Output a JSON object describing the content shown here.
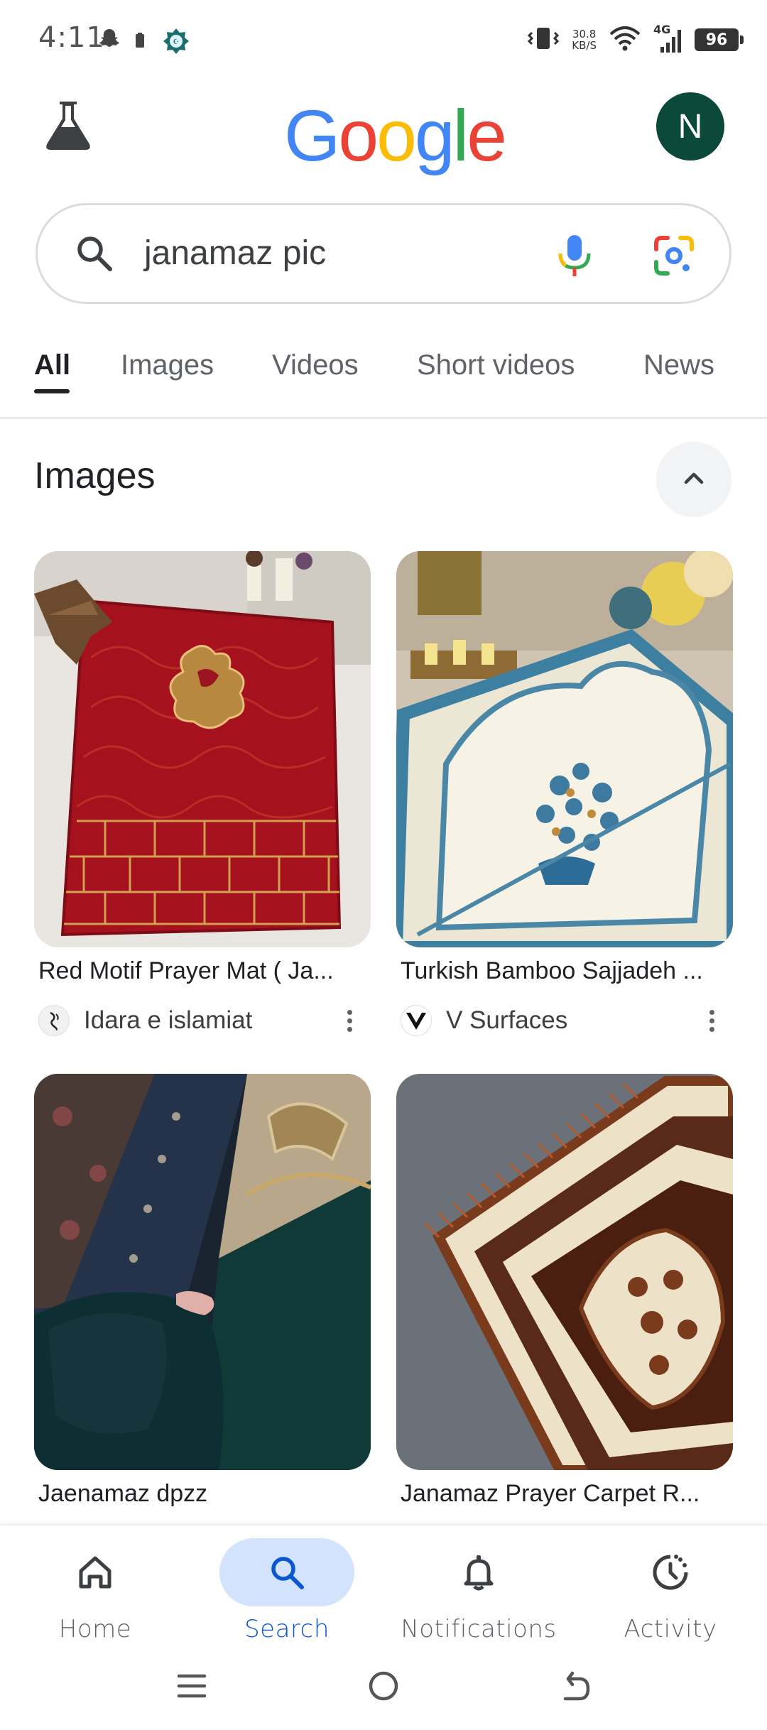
{
  "status_bar": {
    "time": "4:11",
    "net_speed_value": "30.8",
    "net_speed_unit": "KB/S",
    "network_type": "4G",
    "battery": "96"
  },
  "header": {
    "logo_text": "Google",
    "avatar_letter": "N",
    "logo_colors": [
      "#4285F4",
      "#EA4335",
      "#FBBC05",
      "#4285F4",
      "#34A853",
      "#EA4335"
    ]
  },
  "search": {
    "query": "janamaz pic"
  },
  "tabs": [
    {
      "label": "All",
      "active": true
    },
    {
      "label": "Images",
      "active": false
    },
    {
      "label": "Videos",
      "active": false
    },
    {
      "label": "Short videos",
      "active": false
    },
    {
      "label": "News",
      "active": false
    }
  ],
  "images_section": {
    "title": "Images",
    "results": [
      {
        "title": "Red Motif Prayer Mat ( Ja...",
        "source": "Idara e islamiat",
        "favicon": "calligraphy-icon"
      },
      {
        "title": "Turkish Bamboo Sajjadeh ...",
        "source": "V Surfaces",
        "favicon": "v-logo-icon"
      },
      {
        "title": "Jaenamaz dpzz",
        "source": "",
        "favicon": ""
      },
      {
        "title": "Janamaz Prayer Carpet R...",
        "source": "",
        "favicon": ""
      }
    ]
  },
  "bottom_nav": [
    {
      "label": "Home",
      "icon": "home-icon",
      "active": false
    },
    {
      "label": "Search",
      "icon": "search-icon",
      "active": true
    },
    {
      "label": "Notifications",
      "icon": "bell-icon",
      "active": false
    },
    {
      "label": "Activity",
      "icon": "activity-icon",
      "active": false
    }
  ],
  "colors": {
    "accent": "#0b57d0",
    "active_nav_bg": "#d3e3fd",
    "avatar_bg": "#0b4a3a"
  }
}
